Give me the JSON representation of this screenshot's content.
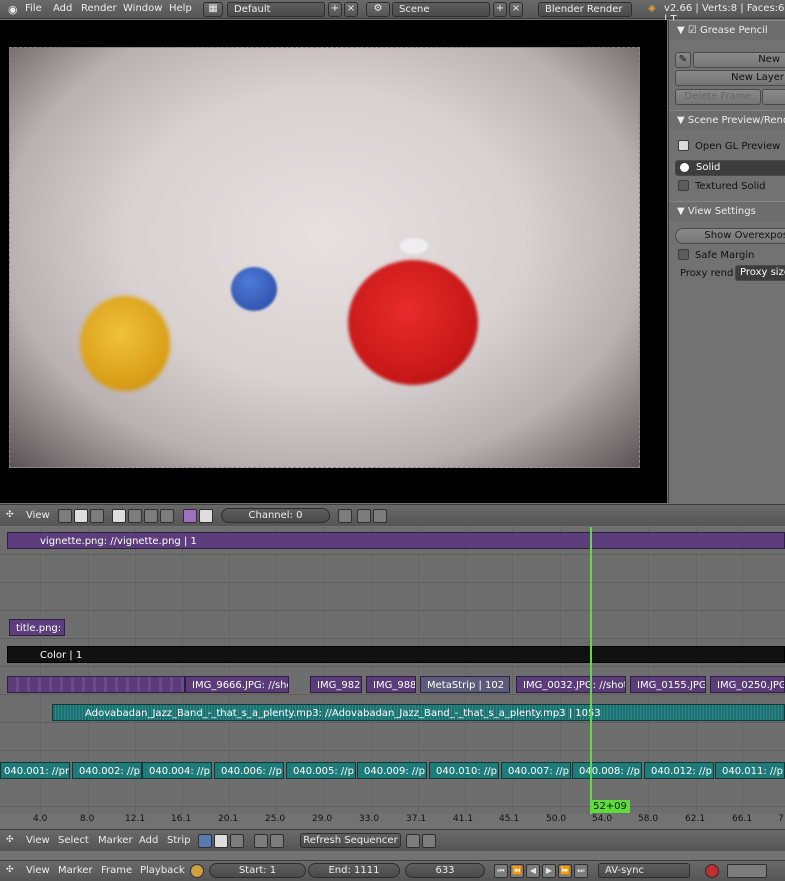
{
  "topbar": {
    "menus": [
      "File",
      "Add",
      "Render",
      "Window",
      "Help"
    ],
    "layout": "Default",
    "scene": "Scene",
    "engine": "Blender Render",
    "stats": "v2.66 | Verts:8 | Faces:6 | T"
  },
  "side": {
    "grease_pencil": "Grease Pencil",
    "new_label": "New",
    "new_layer": "New Layer",
    "delete_frame": "Delete Frame",
    "scene_preview": "Scene Preview/Rende",
    "open_gl_preview": "Open GL Preview",
    "solid": "Solid",
    "textured_solid": "Textured Solid",
    "view_settings": "View Settings",
    "show_overexposed": "Show Overexpos",
    "safe_margin": "Safe Margin",
    "proxy_render": "Proxy rend",
    "proxy_size": "Proxy size"
  },
  "seq_header": {
    "view": "View",
    "channel": "Channel: 0"
  },
  "strips": {
    "vignette": "vignette.png: //vignette.png | 1",
    "title": "title.png:",
    "color": "Color | 1",
    "img_strips": [
      "IMG_9666.JPG: //sho",
      "IMG_982",
      "IMG_988",
      "MetaStrip | 102",
      "IMG_0032.JPG: //shot1",
      "IMG_0155.JPG:",
      "IMG_0250.JPG: //"
    ],
    "audio": "Adovabadan_Jazz_Band_-_that_s_a_plenty.mp3: //Adovabadan_Jazz_Band_-_that_s_a_plenty.mp3 | 1053",
    "bottom_strips": [
      "040.001: //pr",
      "040.002: //p",
      "040.004: //p",
      "040.006: //p",
      "040.005: //p",
      "040.009: //p",
      "040.010: //p",
      "040.007: //p",
      "040.008: //p",
      "040.012: //p",
      "040.011: //p"
    ],
    "playhead": "52+09"
  },
  "ruler": [
    "4.0",
    "8.0",
    "12.1",
    "16.1",
    "20.1",
    "25.0",
    "29.0",
    "33.0",
    "37.1",
    "41.1",
    "45.1",
    "50.0",
    "54.0",
    "58.0",
    "62.1",
    "66.1",
    "7"
  ],
  "seq_footer": {
    "menus": [
      "View",
      "Select",
      "Marker",
      "Add",
      "Strip"
    ],
    "refresh": "Refresh Sequencer"
  },
  "timeline": {
    "menus": [
      "View",
      "Marker",
      "Frame",
      "Playback"
    ],
    "start": "Start: 1",
    "end": "End: 1111",
    "current": "633",
    "sync": "AV-sync"
  },
  "colors": {
    "playhead": "#5ddc3c",
    "image_strip": "#5a3c78",
    "audio_strip": "#1f7a7a",
    "color_strip": "#111111"
  }
}
